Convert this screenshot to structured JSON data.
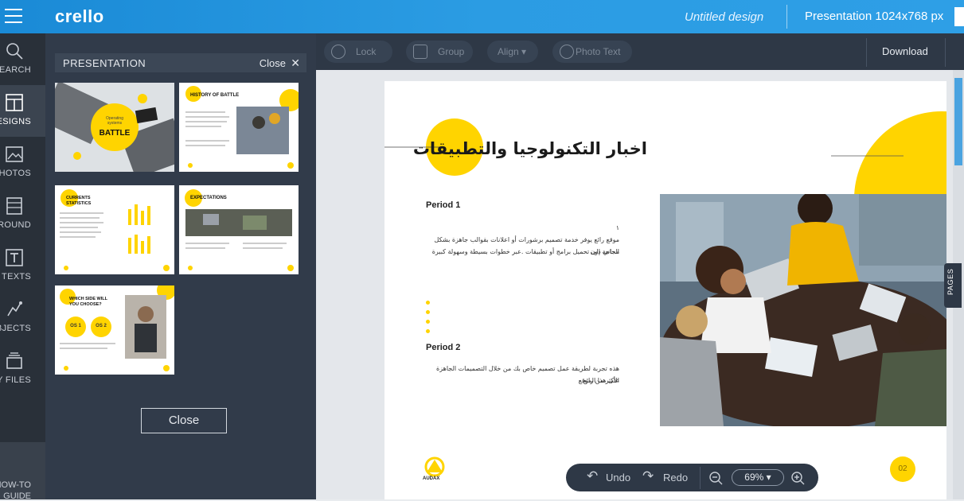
{
  "app": {
    "logo": "crello",
    "design_title": "Untitled design",
    "size_label": "Presentation 1024x768 px"
  },
  "rail": [
    {
      "label": "SEARCH",
      "icon": "search-icon"
    },
    {
      "label": "DESIGNS",
      "icon": "designs-icon"
    },
    {
      "label": "PHOTOS",
      "icon": "photos-icon"
    },
    {
      "label": "BACKGROUND",
      "icon": "background-icon"
    },
    {
      "label": "TEXTS",
      "icon": "texts-icon"
    },
    {
      "label": "OBJECTS",
      "icon": "objects-icon"
    },
    {
      "label": "MY FILES",
      "icon": "my-files-icon"
    }
  ],
  "howto": {
    "line1": "HOW-TO",
    "line2": "GUIDE"
  },
  "panel": {
    "title": "PRESENTATION",
    "close_label": "Close",
    "close_button": "Close",
    "thumbs": [
      {
        "small": "Operating systems",
        "big": "BATTLE"
      },
      {
        "title": "HISTORY OF BATTLE"
      },
      {
        "title": "CURRENTS STATISTICS"
      },
      {
        "title": "EXPECTATIONS"
      },
      {
        "title": "WHICH SIDE WILL YOU CHOOSE?",
        "opt1": "OS 1",
        "opt2": "OS 2"
      }
    ]
  },
  "toolbar": {
    "lock": "Lock",
    "group": "Group",
    "align": "Align ▾",
    "photo_text": "Photo Text",
    "download": "Download"
  },
  "slide": {
    "title": "اخبار التكنولوجيا والتطبيقات",
    "period1": "Period 1",
    "period1_mark": "١",
    "period1_line1": "موقع رائع يوفر خدمة تصميم برشورات أو اعلانات بقوالب جاهزة بشكل مجاني دون",
    "period1_line2": "الحاجة إلى تحميل برامج أو تطبيقات .عبر خطوات بسيطة وسهولة كبيرة",
    "period2": "Period 2",
    "period2_line1": "هذه تجربة لطريقة عمل تصميم خاص بك من خلال التصميمات الجاهزة على هذا الموقع",
    "period2_line2": "الأكثر من رائع",
    "logo_text": "AUDAX",
    "page_number": "02"
  },
  "pages_tab": "PAGES",
  "bottom": {
    "undo": "Undo",
    "redo": "Redo",
    "zoom": "69%"
  },
  "colors": {
    "accent_yellow": "#ffd400",
    "topbar_blue": "#2196e0",
    "panel_dark": "#313b4a"
  }
}
